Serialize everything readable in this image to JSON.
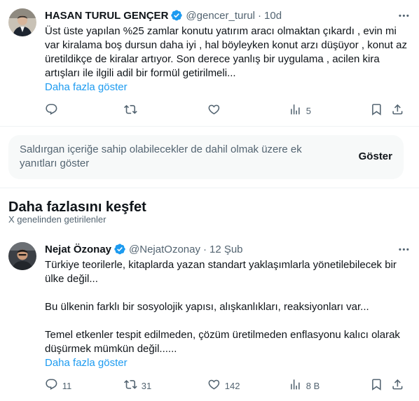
{
  "tweet1": {
    "author_name": "HASAN TURUL GENÇER",
    "handle": "@gencer_turul",
    "separator": "·",
    "time": "10d",
    "text": "Üst üste yapılan %25 zamlar konutu yatırım aracı olmaktan çıkardı , evin mi var kiralama boş dursun daha iyi , hal böyleyken konut arzı düşüyor , konut az üretildikçe de kiralar artıyor. Son derece yanlış bir uygulama , acilen kira artışları ile ilgili adil bir formül getirilmeli...",
    "show_more": "Daha fazla göster",
    "counts": {
      "reply": "",
      "retweet": "",
      "like": "",
      "views": "5"
    }
  },
  "notice": {
    "text": "Saldırgan içeriğe sahip olabilecekler de dahil olmak üzere ek yanıtları göster",
    "button": "Göster"
  },
  "explore": {
    "title": "Daha fazlasını keşfet",
    "subtitle": "X genelinden getirilenler"
  },
  "tweet2": {
    "author_name": "Nejat Özonay",
    "handle": "@NejatOzonay",
    "separator": "·",
    "time": "12 Şub",
    "paragraphs": [
      "Türkiye teorilerle, kitaplarda yazan standart yaklaşımlarla yönetilebilecek bir ülke değil...",
      "Bu ülkenin farklı bir sosyolojik yapısı, alışkanlıkları, reaksiyonları var...",
      "Temel etkenler tespit edilmeden, çözüm üretilmeden enflasyonu kalıcı olarak düşürmek mümkün değil......"
    ],
    "show_more": "Daha fazla göster",
    "counts": {
      "reply": "11",
      "retweet": "31",
      "like": "142",
      "views": "8 B"
    }
  },
  "icons": {
    "verified": "verified-badge-icon",
    "more": "more-dots-icon",
    "reply": "reply-icon",
    "retweet": "retweet-icon",
    "like": "heart-icon",
    "views": "views-chart-icon",
    "bookmark": "bookmark-icon",
    "share": "share-icon"
  },
  "colors": {
    "link": "#1d9bf0",
    "secondary_text": "#536471",
    "verified": "#1d9bf0",
    "notice_bg": "#f7f9f9"
  }
}
